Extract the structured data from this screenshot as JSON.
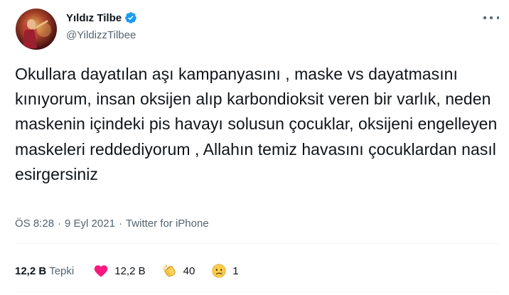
{
  "user": {
    "display_name": "Yıldız Tilbe",
    "handle": "@YildizzTilbee",
    "verified_icon": "verified-badge-icon"
  },
  "tweet": {
    "text": "Okullara dayatılan aşı kampanyasını , maske vs dayatmasını kınıyorum, insan oksijen alıp karbondioksit veren bir varlık, neden maskenin içindeki pis havayı solusun çocuklar, oksijeni engelleyen maskeleri reddediyorum , Allahın temiz havasını çocuklardan nasıl esirgersiniz",
    "time": "ÖS 8:28",
    "date": "9 Eyl 2021",
    "separator": "·",
    "source": "Twitter for iPhone"
  },
  "stats": {
    "reactions_total": "12,2 B",
    "reactions_label": "Tepki",
    "heart_count": "12,2 B",
    "clap_count": "40",
    "sad_count": "1"
  },
  "colors": {
    "text": "#0f1419",
    "secondary": "#536471",
    "verified": "#1d9bf0",
    "heart": "#f91880",
    "divider": "#eff3f4"
  }
}
